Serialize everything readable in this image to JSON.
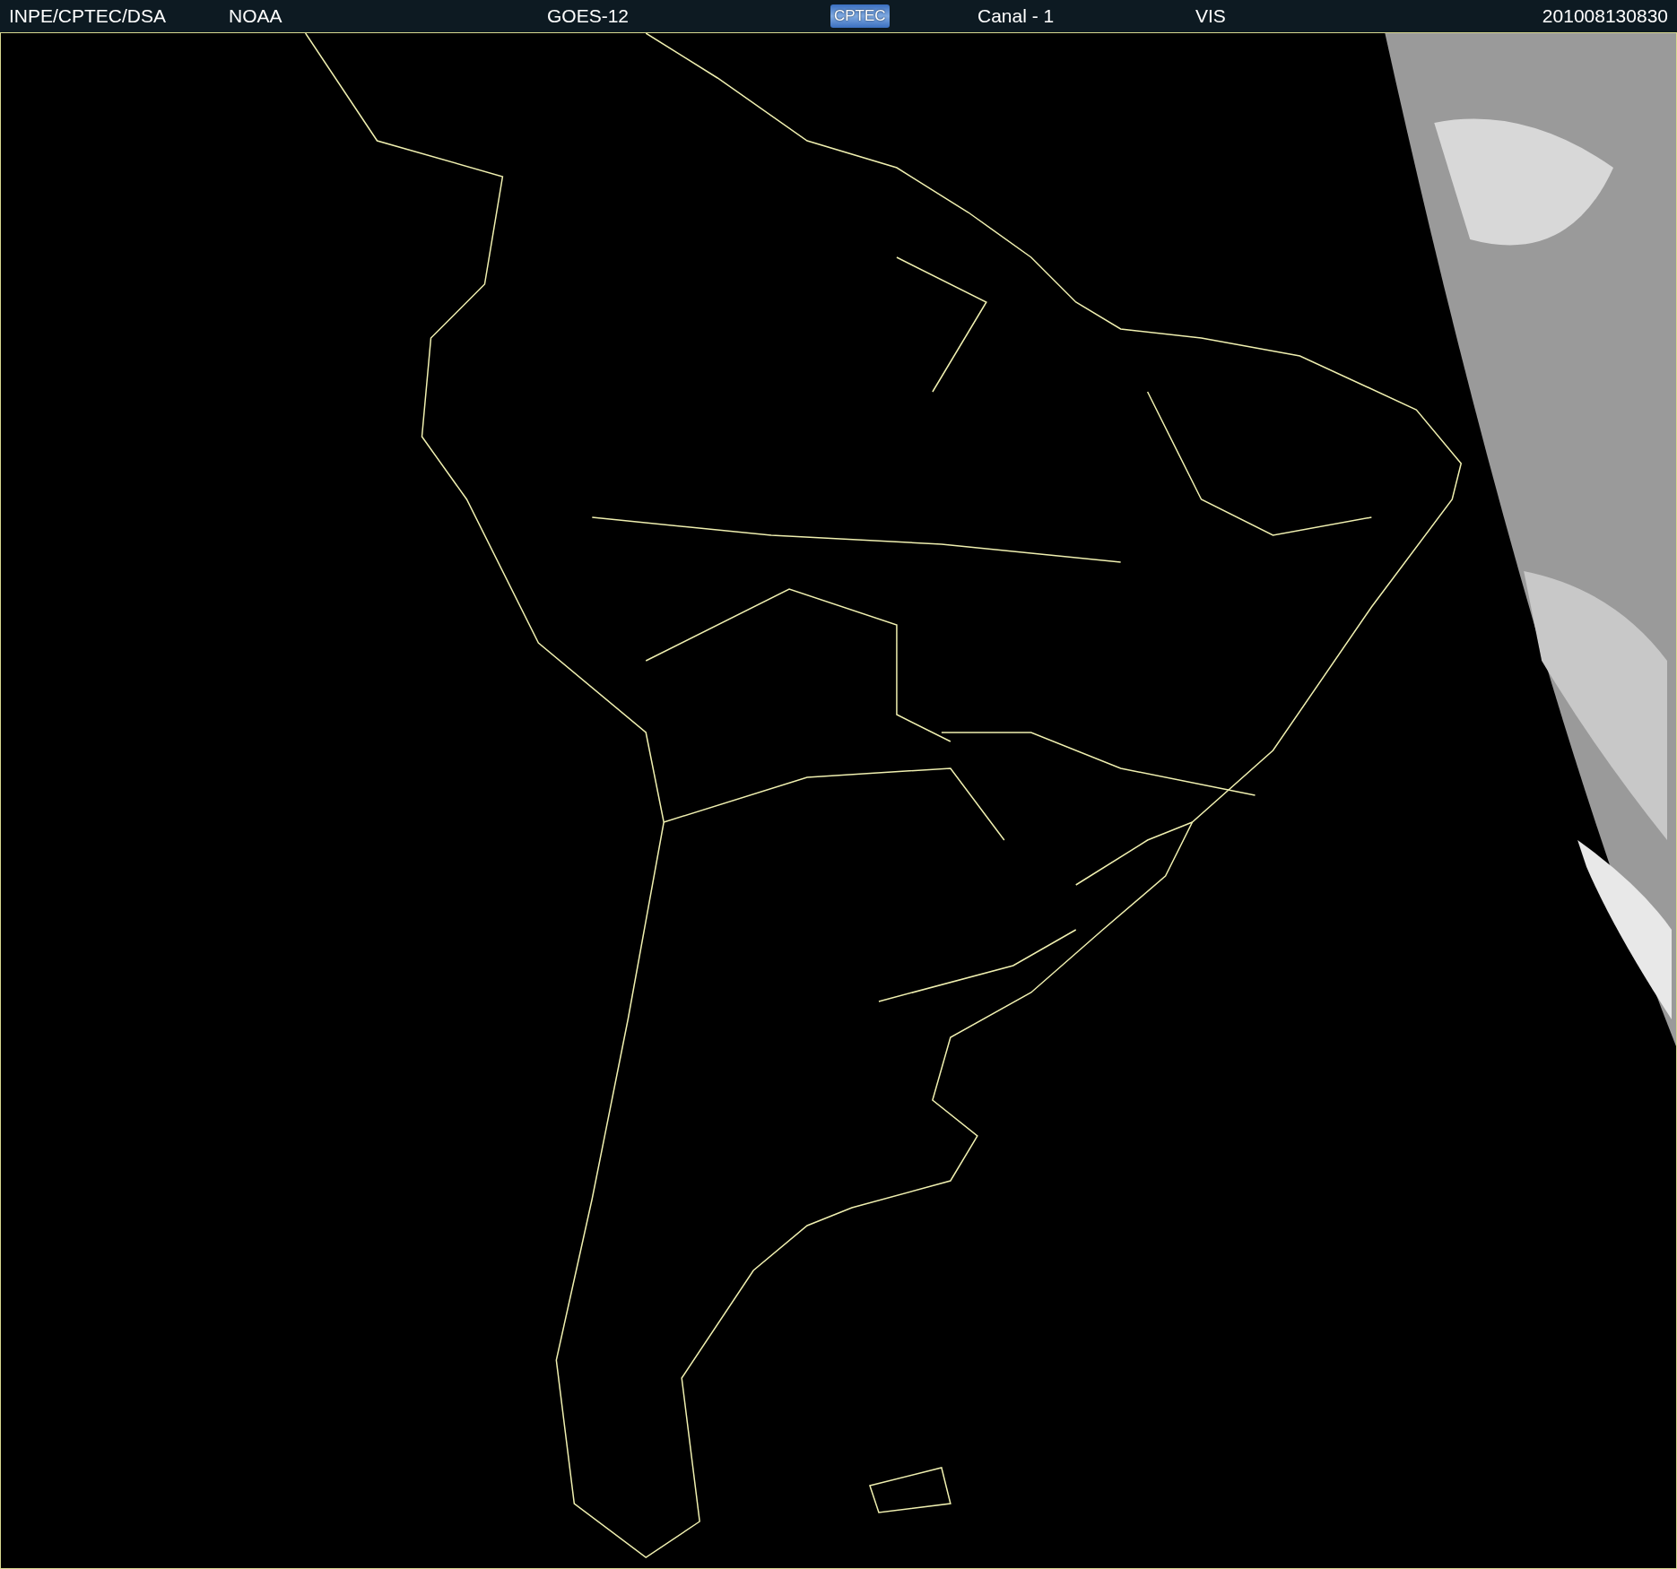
{
  "header": {
    "items": [
      {
        "kind": "text",
        "text": "INPE/CPTEC/DSA"
      },
      {
        "kind": "text",
        "text": "NOAA"
      },
      {
        "kind": "text",
        "text": "GOES-12"
      },
      {
        "kind": "logo",
        "text": "CPTEC"
      },
      {
        "kind": "text",
        "text": "Canal - 1"
      },
      {
        "kind": "text",
        "text": "VIS"
      },
      {
        "kind": "text",
        "text": "201008130830"
      }
    ]
  }
}
